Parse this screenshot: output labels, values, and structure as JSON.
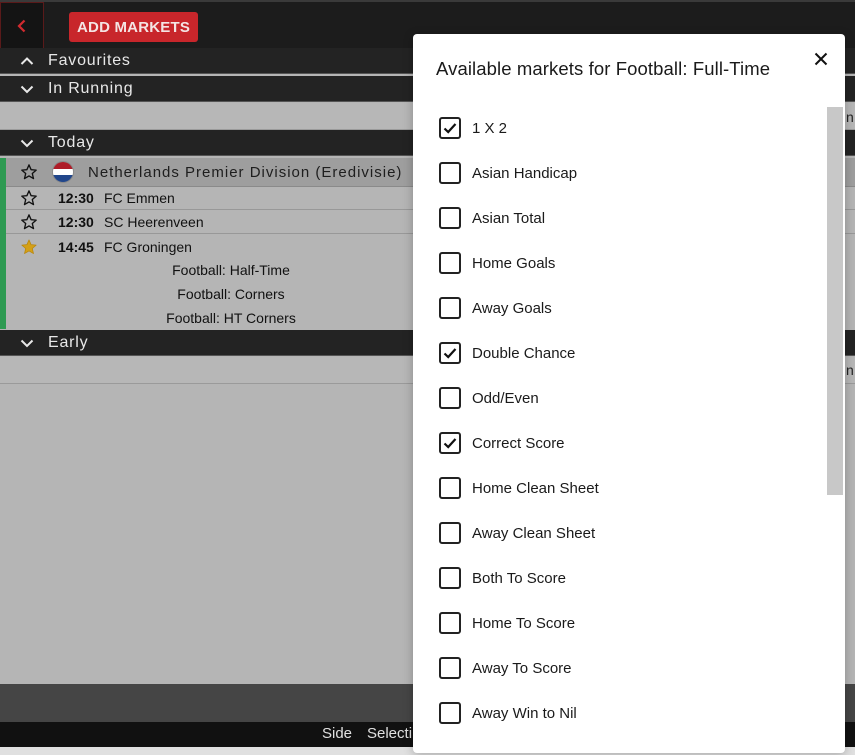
{
  "topbar": {
    "add_markets_label": "ADD MARKETS"
  },
  "sections": {
    "favourites": "Favourites",
    "in_running": "In Running",
    "today": "Today",
    "early": "Early"
  },
  "league": {
    "name": "Netherlands Premier Division (Eredivisie)",
    "flag_colors": [
      "#ae1c28",
      "#ffffff",
      "#21468b"
    ]
  },
  "matches": [
    {
      "time": "12:30",
      "team": "FC Emmen",
      "favourite": false
    },
    {
      "time": "12:30",
      "team": "SC Heerenveen",
      "favourite": false
    },
    {
      "time": "14:45",
      "team": "FC Groningen",
      "favourite": true
    }
  ],
  "sub_markets": [
    "Football: Half-Time",
    "Football: Corners",
    "Football: HT Corners"
  ],
  "footer": {
    "side_label": "Side",
    "selection_label": "Selecti"
  },
  "right_peek": {
    "row1": "n t",
    "row2": "n t"
  },
  "dialog": {
    "title": "Available markets for Football: Full-Time",
    "options": [
      {
        "label": "1 X 2",
        "checked": true
      },
      {
        "label": "Asian Handicap",
        "checked": false
      },
      {
        "label": "Asian Total",
        "checked": false
      },
      {
        "label": "Home Goals",
        "checked": false
      },
      {
        "label": "Away Goals",
        "checked": false
      },
      {
        "label": "Double Chance",
        "checked": true
      },
      {
        "label": "Odd/Even",
        "checked": false
      },
      {
        "label": "Correct Score",
        "checked": true
      },
      {
        "label": "Home Clean Sheet",
        "checked": false
      },
      {
        "label": "Away Clean Sheet",
        "checked": false
      },
      {
        "label": "Both To Score",
        "checked": false
      },
      {
        "label": "Home To Score",
        "checked": false
      },
      {
        "label": "Away To Score",
        "checked": false
      },
      {
        "label": "Away Win to Nil",
        "checked": false
      }
    ]
  },
  "colors": {
    "accent": "#c8262b",
    "favourite_star": "#d4a017",
    "live_bar": "#2e9a52"
  }
}
